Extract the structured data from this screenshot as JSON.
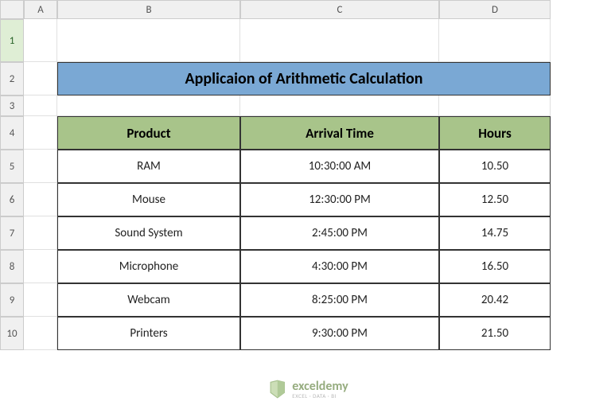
{
  "columns": [
    "A",
    "B",
    "C",
    "D"
  ],
  "rows": [
    "1",
    "2",
    "3",
    "4",
    "5",
    "6",
    "7",
    "8",
    "9",
    "10"
  ],
  "title": "Applicaion of Arithmetic Calculation",
  "table": {
    "headers": {
      "product": "Product",
      "arrival": "Arrival Time",
      "hours": "Hours"
    },
    "rows": [
      {
        "product": "RAM",
        "arrival": "10:30:00 AM",
        "hours": "10.50"
      },
      {
        "product": "Mouse",
        "arrival": "12:30:00 PM",
        "hours": "12.50"
      },
      {
        "product": "Sound System",
        "arrival": "2:45:00 PM",
        "hours": "14.75"
      },
      {
        "product": "Microphone",
        "arrival": "4:30:00 PM",
        "hours": "16.50"
      },
      {
        "product": "Webcam",
        "arrival": "8:25:00 PM",
        "hours": "20.42"
      },
      {
        "product": "Printers",
        "arrival": "9:30:00 PM",
        "hours": "21.50"
      }
    ]
  },
  "watermark": {
    "brand": "exceldemy",
    "tag": "EXCEL · DATA · BI"
  },
  "chart_data": {
    "type": "table",
    "title": "Applicaion of Arithmetic Calculation",
    "columns": [
      "Product",
      "Arrival Time",
      "Hours"
    ],
    "rows": [
      [
        "RAM",
        "10:30:00 AM",
        10.5
      ],
      [
        "Mouse",
        "12:30:00 PM",
        12.5
      ],
      [
        "Sound System",
        "2:45:00 PM",
        14.75
      ],
      [
        "Microphone",
        "4:30:00 PM",
        16.5
      ],
      [
        "Webcam",
        "8:25:00 PM",
        20.42
      ],
      [
        "Printers",
        "9:30:00 PM",
        21.5
      ]
    ]
  }
}
